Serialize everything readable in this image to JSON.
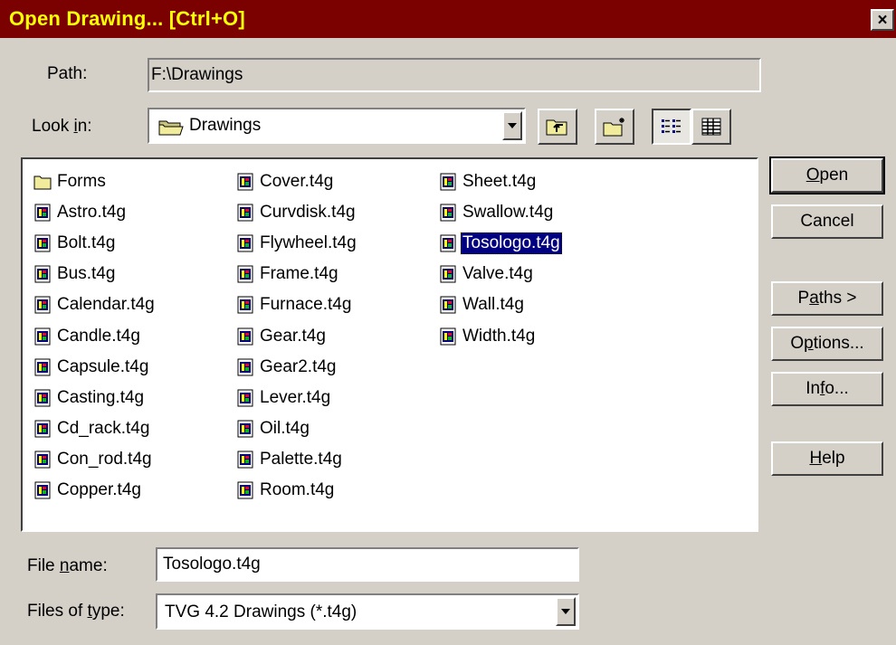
{
  "window": {
    "title": "Open Drawing... [Ctrl+O]",
    "close_glyph": "×",
    "title_color": "#ffff00",
    "titlebar_color": "#7b0000"
  },
  "path": {
    "label": "Path:",
    "value": "F:\\Drawings"
  },
  "look_in": {
    "label_prefix": "Look ",
    "label_accel": "i",
    "label_suffix": "n:",
    "value": "Drawings",
    "icon": "folder-icon"
  },
  "toolbar": {
    "up_folder_icon": "up-folder-icon",
    "new_folder_icon": "new-folder-icon",
    "list_view_icon": "list-view-icon",
    "details_view_icon": "details-view-icon"
  },
  "files": {
    "columns": [
      [
        {
          "name": "Forms",
          "icon": "folder-icon"
        },
        {
          "name": "Astro.t4g",
          "icon": "drawing-file-icon"
        },
        {
          "name": "Bolt.t4g",
          "icon": "drawing-file-icon"
        },
        {
          "name": "Bus.t4g",
          "icon": "drawing-file-icon"
        },
        {
          "name": "Calendar.t4g",
          "icon": "drawing-file-icon"
        },
        {
          "name": "Candle.t4g",
          "icon": "drawing-file-icon"
        },
        {
          "name": "Capsule.t4g",
          "icon": "drawing-file-icon"
        },
        {
          "name": "Casting.t4g",
          "icon": "drawing-file-icon"
        },
        {
          "name": "Cd_rack.t4g",
          "icon": "drawing-file-icon"
        },
        {
          "name": "Con_rod.t4g",
          "icon": "drawing-file-icon"
        },
        {
          "name": "Copper.t4g",
          "icon": "drawing-file-icon"
        }
      ],
      [
        {
          "name": "Cover.t4g",
          "icon": "drawing-file-icon"
        },
        {
          "name": "Curvdisk.t4g",
          "icon": "drawing-file-icon"
        },
        {
          "name": "Flywheel.t4g",
          "icon": "drawing-file-icon"
        },
        {
          "name": "Frame.t4g",
          "icon": "drawing-file-icon"
        },
        {
          "name": "Furnace.t4g",
          "icon": "drawing-file-icon"
        },
        {
          "name": "Gear.t4g",
          "icon": "drawing-file-icon"
        },
        {
          "name": "Gear2.t4g",
          "icon": "drawing-file-icon"
        },
        {
          "name": "Lever.t4g",
          "icon": "drawing-file-icon"
        },
        {
          "name": "Oil.t4g",
          "icon": "drawing-file-icon"
        },
        {
          "name": "Palette.t4g",
          "icon": "drawing-file-icon"
        },
        {
          "name": "Room.t4g",
          "icon": "drawing-file-icon"
        }
      ],
      [
        {
          "name": "Sheet.t4g",
          "icon": "drawing-file-icon"
        },
        {
          "name": "Swallow.t4g",
          "icon": "drawing-file-icon"
        },
        {
          "name": "Tosologo.t4g",
          "icon": "drawing-file-icon",
          "selected": true
        },
        {
          "name": "Valve.t4g",
          "icon": "drawing-file-icon"
        },
        {
          "name": "Wall.t4g",
          "icon": "drawing-file-icon"
        },
        {
          "name": "Width.t4g",
          "icon": "drawing-file-icon"
        }
      ]
    ]
  },
  "buttons": {
    "open": {
      "accel": "O",
      "rest": "pen"
    },
    "cancel": "Cancel",
    "paths": {
      "prefix": "P",
      "accel": "a",
      "rest": "ths >"
    },
    "options": {
      "prefix": "O",
      "accel": "p",
      "rest": "tions..."
    },
    "info": {
      "prefix": "In",
      "accel": "f",
      "rest": "o..."
    },
    "help": {
      "accel": "H",
      "rest": "elp"
    }
  },
  "file_name": {
    "label_prefix": "File ",
    "label_accel": "n",
    "label_suffix": "ame:",
    "value": "Tosologo.t4g"
  },
  "file_type": {
    "label_prefix": "Files of ",
    "label_accel": "t",
    "label_suffix": "ype:",
    "value": "TVG 4.2 Drawings (*.t4g)"
  }
}
